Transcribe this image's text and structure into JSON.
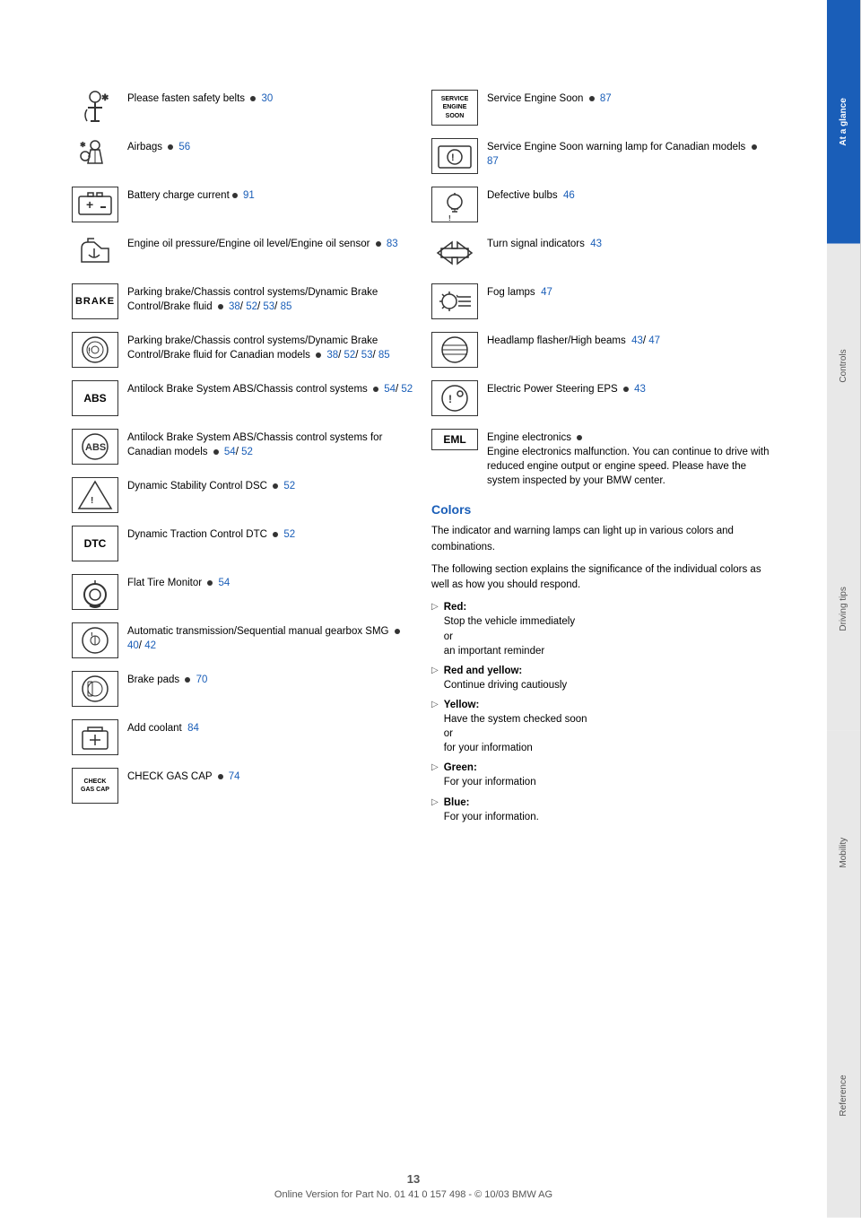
{
  "page": {
    "number": "13",
    "footer_text": "Online Version for Part No. 01 41 0 157 498 - © 10/03 BMW AG"
  },
  "tabs": [
    {
      "label": "At a glance",
      "active": true
    },
    {
      "label": "Controls",
      "active": false
    },
    {
      "label": "Driving tips",
      "active": false
    },
    {
      "label": "Mobility",
      "active": false
    },
    {
      "label": "Reference",
      "active": false
    }
  ],
  "left_items": [
    {
      "id": "seatbelt",
      "text": "Please fasten safety belts",
      "dot": true,
      "links": [
        "30"
      ]
    },
    {
      "id": "airbags",
      "text": "Airbags",
      "dot": true,
      "links": [
        "56"
      ]
    },
    {
      "id": "battery",
      "text": "Battery charge current",
      "dot": true,
      "links": [
        "91"
      ]
    },
    {
      "id": "engine-oil",
      "text": "Engine oil pressure/Engine oil level/Engine oil sensor",
      "dot": true,
      "links": [
        "83"
      ]
    },
    {
      "id": "brake-box",
      "text": "Parking brake/Chassis control systems/Dynamic Brake Control/Brake fluid",
      "dot": true,
      "links": [
        "38",
        "52",
        "53",
        "85"
      ]
    },
    {
      "id": "brake-circle",
      "text": "Parking brake/Chassis control systems/Dynamic Brake Control/Brake fluid for Canadian models",
      "dot": true,
      "links": [
        "38",
        "52",
        "53",
        "85"
      ]
    },
    {
      "id": "abs-box",
      "text": "Antilock Brake System ABS/Chassis control systems",
      "dot": true,
      "links": [
        "54",
        "52"
      ]
    },
    {
      "id": "abs-circle",
      "text": "Antilock Brake System ABS/Chassis control systems for Canadian models",
      "dot": true,
      "links": [
        "54",
        "52"
      ]
    },
    {
      "id": "dsc",
      "text": "Dynamic Stability Control DSC",
      "dot": true,
      "links": [
        "52"
      ]
    },
    {
      "id": "dtc",
      "text": "Dynamic Traction Control DTC",
      "dot": true,
      "links": [
        "52"
      ]
    },
    {
      "id": "flat-tire",
      "text": "Flat Tire Monitor",
      "dot": true,
      "links": [
        "54"
      ]
    },
    {
      "id": "auto-trans",
      "text": "Automatic transmission/Sequential manual gearbox SMG",
      "dot": true,
      "links": [
        "40",
        "42"
      ]
    },
    {
      "id": "brake-pads",
      "text": "Brake pads",
      "dot": true,
      "links": [
        "70"
      ]
    },
    {
      "id": "coolant",
      "text": "Add coolant",
      "links": [
        "84"
      ]
    },
    {
      "id": "gas-cap",
      "text": "CHECK GAS CAP",
      "dot": true,
      "links": [
        "74"
      ]
    }
  ],
  "right_items": [
    {
      "id": "service-engine",
      "text": "Service Engine Soon",
      "dot": true,
      "links": [
        "87"
      ]
    },
    {
      "id": "service-engine-canada",
      "text": "Service Engine Soon warning lamp for Canadian models",
      "dot": true,
      "links": [
        "87"
      ]
    },
    {
      "id": "defective-bulbs",
      "text": "Defective bulbs",
      "links": [
        "46"
      ]
    },
    {
      "id": "turn-signal",
      "text": "Turn signal indicators",
      "links": [
        "43"
      ]
    },
    {
      "id": "fog-lamps",
      "text": "Fog lamps",
      "links": [
        "47"
      ]
    },
    {
      "id": "headlamp",
      "text": "Headlamp flasher/High beams",
      "links": [
        "43",
        "47"
      ]
    },
    {
      "id": "eps",
      "text": "Electric Power Steering EPS",
      "dot": true,
      "links": [
        "43"
      ]
    },
    {
      "id": "eml",
      "text": "Engine electronics",
      "dot": true,
      "sub_text": "Engine electronics malfunction. You can continue to drive with reduced engine output or engine speed. Please have the system inspected by your BMW center.",
      "links": []
    }
  ],
  "colors_section": {
    "title": "Colors",
    "desc1": "The indicator and warning lamps can light up in various colors and combinations.",
    "desc2": "The following section explains the significance of the individual colors as well as how you should respond.",
    "items": [
      {
        "color": "Red:",
        "text": "Stop the vehicle immediately\nor\nan important reminder"
      },
      {
        "color": "Red and yellow:",
        "text": "Continue driving cautiously"
      },
      {
        "color": "Yellow:",
        "text": "Have the system checked soon\nor\nfor your information"
      },
      {
        "color": "Green:",
        "text": "For your information"
      },
      {
        "color": "Blue:",
        "text": "For your information."
      }
    ]
  }
}
